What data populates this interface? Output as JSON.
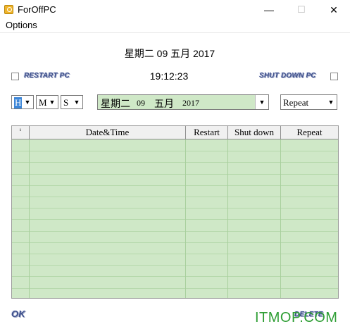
{
  "window": {
    "title": "ForOffPC",
    "minimize_glyph": "—",
    "maximize_glyph": "☐",
    "close_glyph": "✕"
  },
  "menu": {
    "options": "Options"
  },
  "date_display": "星期二 09 五月 2017",
  "time_display": "19:12:23",
  "restart_label": "RESTART PC",
  "shutdown_label": "SHUT DOWN PC",
  "controls": {
    "hour": "H",
    "minute": "M",
    "second": "S",
    "date_weekday": "星期二",
    "date_day": "09",
    "date_month": "五月",
    "date_year": "2017",
    "repeat": "Repeat",
    "dropdown_arrow": "▼"
  },
  "table": {
    "columns": [
      "¹",
      "Date&Time",
      "Restart",
      "Shut down",
      "Repeat"
    ],
    "rows": []
  },
  "buttons": {
    "ok": "OK",
    "delete": "DELETE"
  },
  "watermark": "ITMOP.COM",
  "colors": {
    "grid_bg": "#cfe8c7",
    "label_blue": "#3b4d8a",
    "watermark_green": "#2e9e34"
  }
}
